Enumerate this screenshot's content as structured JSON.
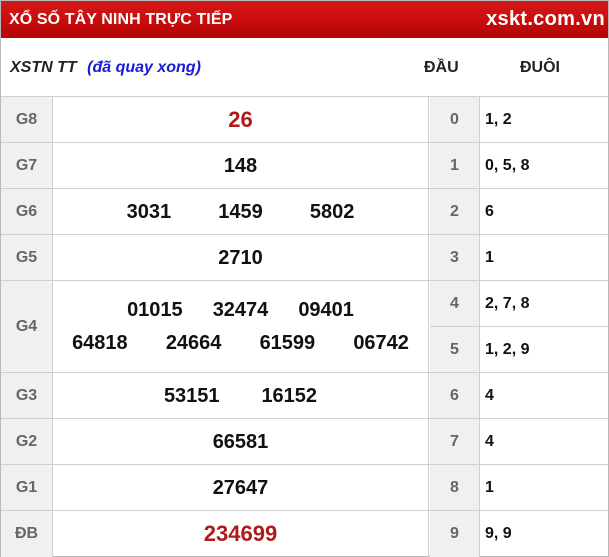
{
  "header": {
    "title": "XỔ SỐ TÂY NINH TRỰC TIẾP",
    "logo": "xskt.com.vn"
  },
  "subheader": {
    "label": "XSTN TT",
    "status": "(đã quay xong)",
    "col_dau": "ĐẦU",
    "col_duoi": "ĐUÔI"
  },
  "prizes": [
    {
      "label": "G8",
      "numbers": [
        "26"
      ]
    },
    {
      "label": "G7",
      "numbers": [
        "148"
      ]
    },
    {
      "label": "G6",
      "numbers": [
        "3031",
        "1459",
        "5802"
      ]
    },
    {
      "label": "G5",
      "numbers": [
        "2710"
      ]
    },
    {
      "label": "G4",
      "numbers": [
        "01015",
        "32474",
        "09401",
        "64818",
        "24664",
        "61599",
        "06742"
      ]
    },
    {
      "label": "G3",
      "numbers": [
        "53151",
        "16152"
      ]
    },
    {
      "label": "G2",
      "numbers": [
        "66581"
      ]
    },
    {
      "label": "G1",
      "numbers": [
        "27647"
      ]
    },
    {
      "label": "ĐB",
      "numbers": [
        "234699"
      ]
    }
  ],
  "loto": [
    {
      "dau": "0",
      "duoi": "1, 2"
    },
    {
      "dau": "1",
      "duoi": "0, 5, 8"
    },
    {
      "dau": "2",
      "duoi": "6"
    },
    {
      "dau": "3",
      "duoi": "1"
    },
    {
      "dau": "4",
      "duoi": "2, 7, 8"
    },
    {
      "dau": "5",
      "duoi": "1, 2, 9"
    },
    {
      "dau": "6",
      "duoi": "4"
    },
    {
      "dau": "7",
      "duoi": "4"
    },
    {
      "dau": "8",
      "duoi": "1"
    },
    {
      "dau": "9",
      "duoi": "9, 9"
    }
  ],
  "colors": {
    "header_bg": "#c80c0c",
    "status_blue": "#1a1ad6",
    "highlight_red": "#b01a1a",
    "label_bg": "#f0f0f0"
  }
}
